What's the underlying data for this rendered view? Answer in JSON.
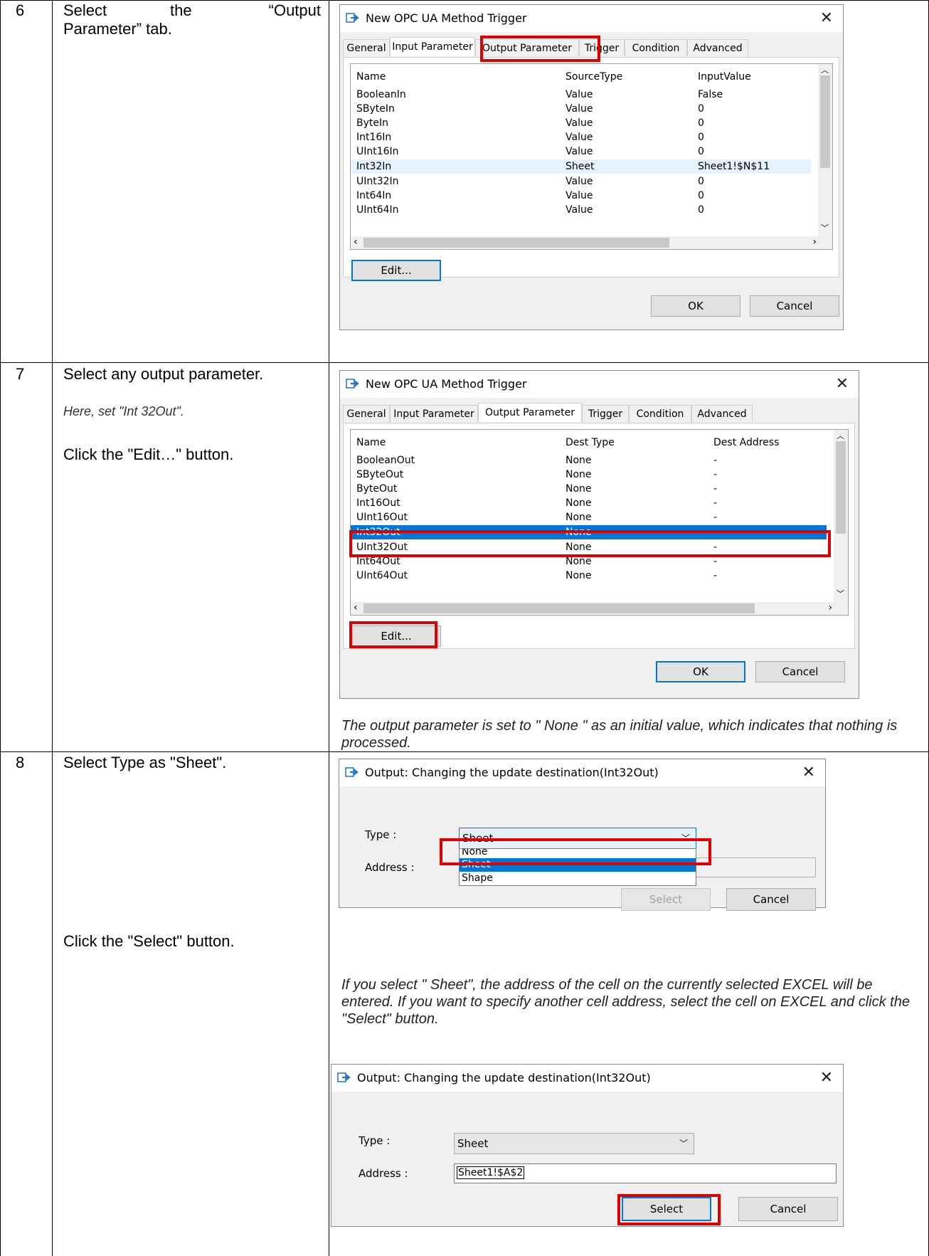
{
  "rows": [
    {
      "number": "6",
      "desc_line1_a": "Select",
      "desc_line1_b": "the",
      "desc_line1_c": "“Output",
      "desc_line2": "Parameter” tab."
    },
    {
      "number": "7",
      "desc_main": "Select any output parameter.",
      "desc_note": "Here, set \"Int 32Out\".",
      "desc_click": "Click the \"Edit…\" button.",
      "italic_note": "The output parameter is set to \" None \" as an initial value, which indicates that nothing is processed."
    },
    {
      "number": "8",
      "desc_main": "Select Type as \"Sheet\".",
      "desc_click": "Click the \"Select\" button.",
      "italic_note": "If you select \" Sheet\", the address of the cell on the currently selected EXCEL will be entered. If you want to specify another cell address, select the cell on EXCEL and click the \"Select\" button."
    }
  ],
  "dialog1": {
    "title": "New OPC UA Method Trigger",
    "tabs": [
      "General",
      "Input Parameter",
      "Output Parameter",
      "Trigger",
      "Condition",
      "Advanced"
    ],
    "columns": [
      "Name",
      "SourceType",
      "InputValue"
    ],
    "items": [
      [
        "BooleanIn",
        "Value",
        "False"
      ],
      [
        "SByteIn",
        "Value",
        "0"
      ],
      [
        "ByteIn",
        "Value",
        "0"
      ],
      [
        "Int16In",
        "Value",
        "0"
      ],
      [
        "UInt16In",
        "Value",
        "0"
      ],
      [
        "Int32In",
        "Sheet",
        "Sheet1!$N$11"
      ],
      [
        "UInt32In",
        "Value",
        "0"
      ],
      [
        "Int64In",
        "Value",
        "0"
      ],
      [
        "UInt64In",
        "Value",
        "0"
      ]
    ],
    "edit_label": "Edit...",
    "ok_label": "OK",
    "cancel_label": "Cancel"
  },
  "dialog2": {
    "title": "New OPC UA Method Trigger",
    "tabs": [
      "General",
      "Input Parameter",
      "Output Parameter",
      "Trigger",
      "Condition",
      "Advanced"
    ],
    "columns": [
      "Name",
      "Dest Type",
      "Dest Address"
    ],
    "items": [
      [
        "BooleanOut",
        "None",
        "-"
      ],
      [
        "SByteOut",
        "None",
        "-"
      ],
      [
        "ByteOut",
        "None",
        "-"
      ],
      [
        "Int16Out",
        "None",
        "-"
      ],
      [
        "UInt16Out",
        "None",
        "-"
      ],
      [
        "Int32Out",
        "None",
        "-"
      ],
      [
        "UInt32Out",
        "None",
        "-"
      ],
      [
        "Int64Out",
        "None",
        "-"
      ],
      [
        "UInt64Out",
        "None",
        "-"
      ]
    ],
    "edit_label": "Edit...",
    "ok_label": "OK",
    "cancel_label": "Cancel"
  },
  "dialog3": {
    "title": "Output: Changing the update destination(Int32Out)",
    "type_label": "Type :",
    "address_label": "Address :",
    "type_value": "Sheet",
    "options": [
      "None",
      "Sheet",
      "Shape"
    ],
    "select_label": "Select",
    "cancel_label": "Cancel"
  },
  "dialog4": {
    "title": "Output: Changing the update destination(Int32Out)",
    "type_label": "Type :",
    "address_label": "Address :",
    "type_value": "Sheet",
    "address_value": "Sheet1!$A$2",
    "select_label": "Select",
    "cancel_label": "Cancel"
  },
  "colors": {
    "highlight": "#e00000",
    "selection": "#0078d7",
    "icon_blue": "#1e73c8"
  }
}
